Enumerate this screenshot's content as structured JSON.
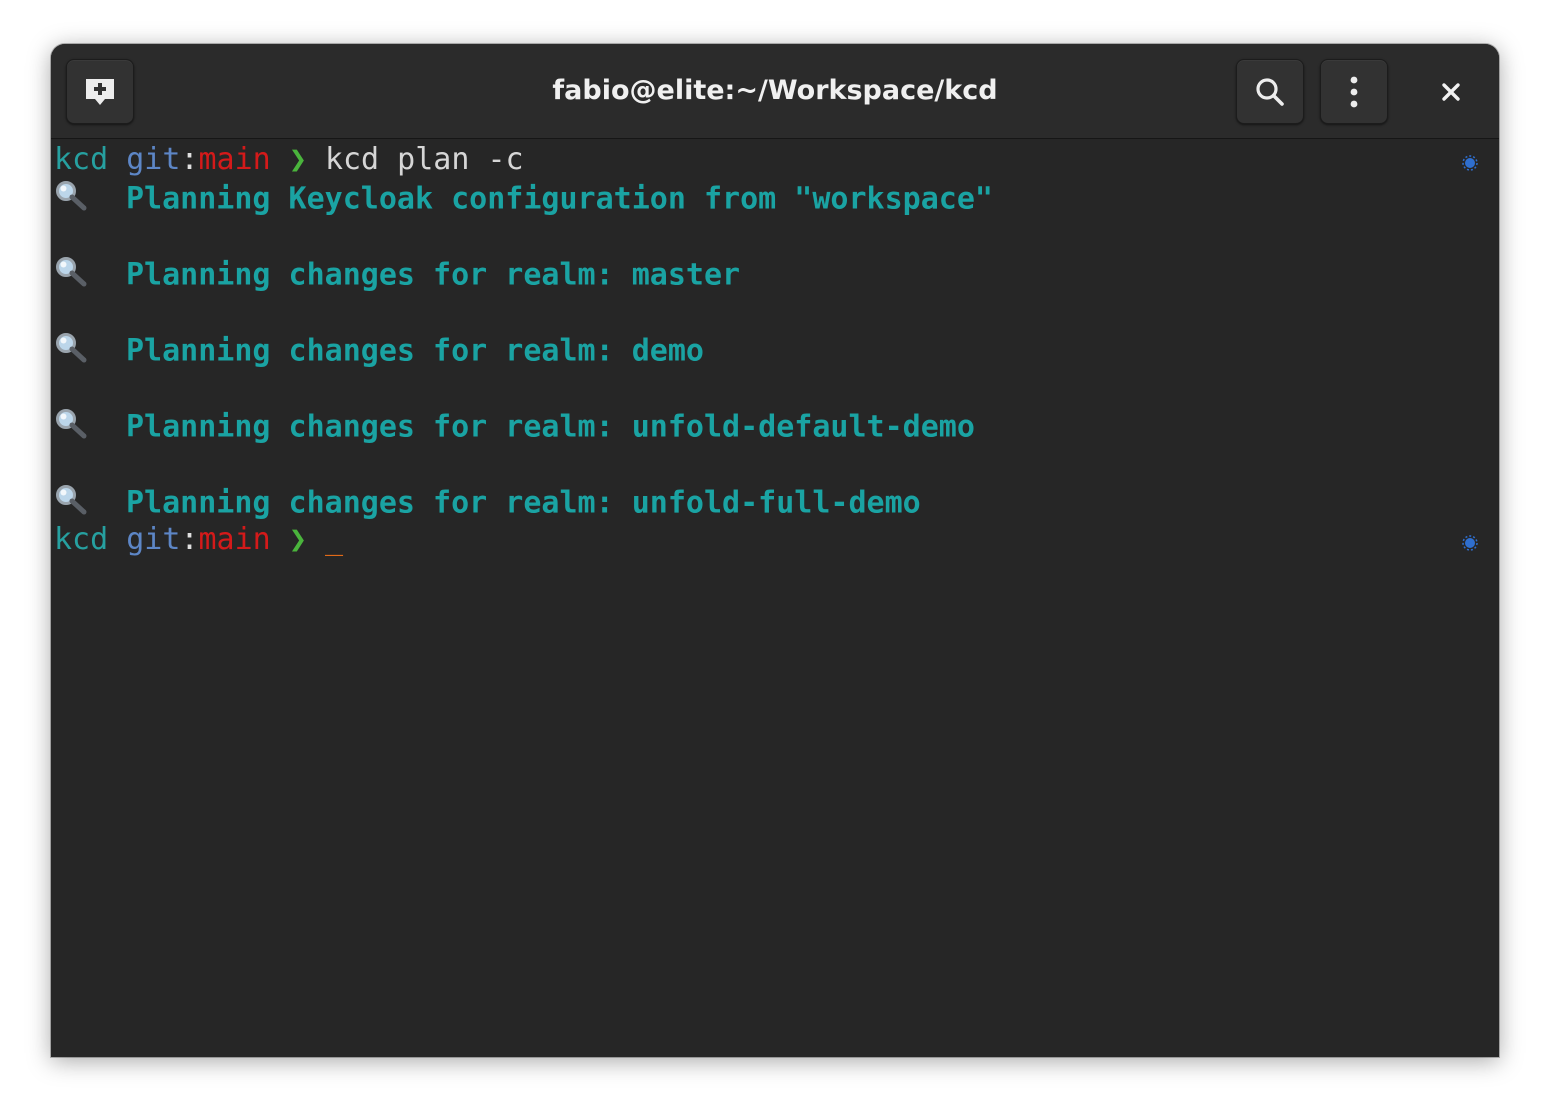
{
  "window": {
    "title": "fabio@elite:~/Workspace/kcd"
  },
  "icons": {
    "new_tab": "new-tab-icon",
    "search": "search-icon",
    "menu": "kebab-menu-icon",
    "close": "close-icon",
    "output_prefix": "magnifying-glass-icon",
    "marker": "prompt-marker-icon"
  },
  "colors": {
    "background": "#262626",
    "titlebar": "#2b2b2b",
    "prompt_dir": "#26a0a0",
    "prompt_git": "#5d86c6",
    "prompt_branch": "#d41a1a",
    "prompt_arrow": "#4ab43c",
    "output_text": "#1aa3a3",
    "cursor": "#e06a18",
    "marker": "#2f6fd0"
  },
  "terminal": {
    "prompt1": {
      "dir": "kcd",
      "git_label": "git",
      "colon": ":",
      "branch": "main",
      "arrow": "❯",
      "command": "kcd plan -c"
    },
    "output": [
      "Planning Keycloak configuration from \"workspace\"",
      "Planning changes for realm: master",
      "Planning changes for realm: demo",
      "Planning changes for realm: unfold-default-demo",
      "Planning changes for realm: unfold-full-demo"
    ],
    "prompt2": {
      "dir": "kcd",
      "git_label": "git",
      "colon": ":",
      "branch": "main",
      "arrow": "❯",
      "cursor": "_"
    }
  }
}
